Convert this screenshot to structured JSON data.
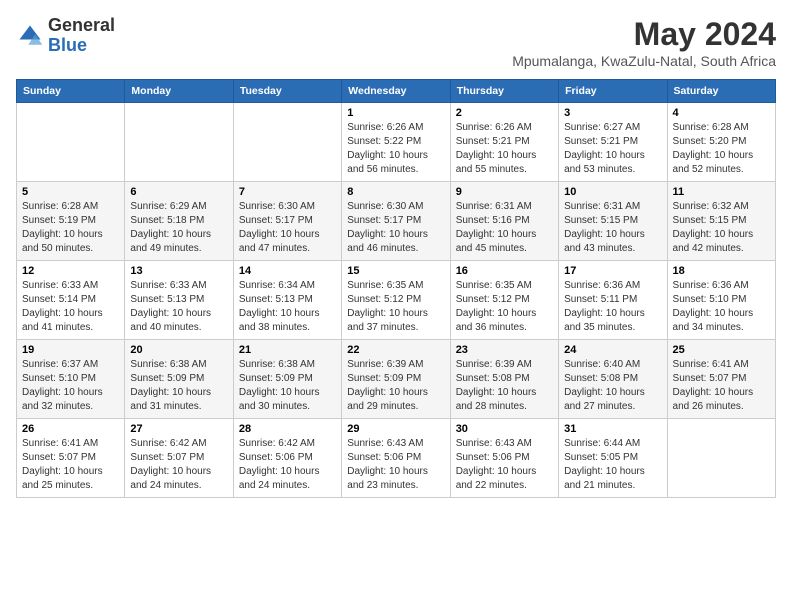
{
  "logo": {
    "general": "General",
    "blue": "Blue"
  },
  "title": "May 2024",
  "location": "Mpumalanga, KwaZulu-Natal, South Africa",
  "weekdays": [
    "Sunday",
    "Monday",
    "Tuesday",
    "Wednesday",
    "Thursday",
    "Friday",
    "Saturday"
  ],
  "weeks": [
    [
      {
        "day": "",
        "info": ""
      },
      {
        "day": "",
        "info": ""
      },
      {
        "day": "",
        "info": ""
      },
      {
        "day": "1",
        "info": "Sunrise: 6:26 AM\nSunset: 5:22 PM\nDaylight: 10 hours\nand 56 minutes."
      },
      {
        "day": "2",
        "info": "Sunrise: 6:26 AM\nSunset: 5:21 PM\nDaylight: 10 hours\nand 55 minutes."
      },
      {
        "day": "3",
        "info": "Sunrise: 6:27 AM\nSunset: 5:21 PM\nDaylight: 10 hours\nand 53 minutes."
      },
      {
        "day": "4",
        "info": "Sunrise: 6:28 AM\nSunset: 5:20 PM\nDaylight: 10 hours\nand 52 minutes."
      }
    ],
    [
      {
        "day": "5",
        "info": "Sunrise: 6:28 AM\nSunset: 5:19 PM\nDaylight: 10 hours\nand 50 minutes."
      },
      {
        "day": "6",
        "info": "Sunrise: 6:29 AM\nSunset: 5:18 PM\nDaylight: 10 hours\nand 49 minutes."
      },
      {
        "day": "7",
        "info": "Sunrise: 6:30 AM\nSunset: 5:17 PM\nDaylight: 10 hours\nand 47 minutes."
      },
      {
        "day": "8",
        "info": "Sunrise: 6:30 AM\nSunset: 5:17 PM\nDaylight: 10 hours\nand 46 minutes."
      },
      {
        "day": "9",
        "info": "Sunrise: 6:31 AM\nSunset: 5:16 PM\nDaylight: 10 hours\nand 45 minutes."
      },
      {
        "day": "10",
        "info": "Sunrise: 6:31 AM\nSunset: 5:15 PM\nDaylight: 10 hours\nand 43 minutes."
      },
      {
        "day": "11",
        "info": "Sunrise: 6:32 AM\nSunset: 5:15 PM\nDaylight: 10 hours\nand 42 minutes."
      }
    ],
    [
      {
        "day": "12",
        "info": "Sunrise: 6:33 AM\nSunset: 5:14 PM\nDaylight: 10 hours\nand 41 minutes."
      },
      {
        "day": "13",
        "info": "Sunrise: 6:33 AM\nSunset: 5:13 PM\nDaylight: 10 hours\nand 40 minutes."
      },
      {
        "day": "14",
        "info": "Sunrise: 6:34 AM\nSunset: 5:13 PM\nDaylight: 10 hours\nand 38 minutes."
      },
      {
        "day": "15",
        "info": "Sunrise: 6:35 AM\nSunset: 5:12 PM\nDaylight: 10 hours\nand 37 minutes."
      },
      {
        "day": "16",
        "info": "Sunrise: 6:35 AM\nSunset: 5:12 PM\nDaylight: 10 hours\nand 36 minutes."
      },
      {
        "day": "17",
        "info": "Sunrise: 6:36 AM\nSunset: 5:11 PM\nDaylight: 10 hours\nand 35 minutes."
      },
      {
        "day": "18",
        "info": "Sunrise: 6:36 AM\nSunset: 5:10 PM\nDaylight: 10 hours\nand 34 minutes."
      }
    ],
    [
      {
        "day": "19",
        "info": "Sunrise: 6:37 AM\nSunset: 5:10 PM\nDaylight: 10 hours\nand 32 minutes."
      },
      {
        "day": "20",
        "info": "Sunrise: 6:38 AM\nSunset: 5:09 PM\nDaylight: 10 hours\nand 31 minutes."
      },
      {
        "day": "21",
        "info": "Sunrise: 6:38 AM\nSunset: 5:09 PM\nDaylight: 10 hours\nand 30 minutes."
      },
      {
        "day": "22",
        "info": "Sunrise: 6:39 AM\nSunset: 5:09 PM\nDaylight: 10 hours\nand 29 minutes."
      },
      {
        "day": "23",
        "info": "Sunrise: 6:39 AM\nSunset: 5:08 PM\nDaylight: 10 hours\nand 28 minutes."
      },
      {
        "day": "24",
        "info": "Sunrise: 6:40 AM\nSunset: 5:08 PM\nDaylight: 10 hours\nand 27 minutes."
      },
      {
        "day": "25",
        "info": "Sunrise: 6:41 AM\nSunset: 5:07 PM\nDaylight: 10 hours\nand 26 minutes."
      }
    ],
    [
      {
        "day": "26",
        "info": "Sunrise: 6:41 AM\nSunset: 5:07 PM\nDaylight: 10 hours\nand 25 minutes."
      },
      {
        "day": "27",
        "info": "Sunrise: 6:42 AM\nSunset: 5:07 PM\nDaylight: 10 hours\nand 24 minutes."
      },
      {
        "day": "28",
        "info": "Sunrise: 6:42 AM\nSunset: 5:06 PM\nDaylight: 10 hours\nand 24 minutes."
      },
      {
        "day": "29",
        "info": "Sunrise: 6:43 AM\nSunset: 5:06 PM\nDaylight: 10 hours\nand 23 minutes."
      },
      {
        "day": "30",
        "info": "Sunrise: 6:43 AM\nSunset: 5:06 PM\nDaylight: 10 hours\nand 22 minutes."
      },
      {
        "day": "31",
        "info": "Sunrise: 6:44 AM\nSunset: 5:05 PM\nDaylight: 10 hours\nand 21 minutes."
      },
      {
        "day": "",
        "info": ""
      }
    ]
  ]
}
